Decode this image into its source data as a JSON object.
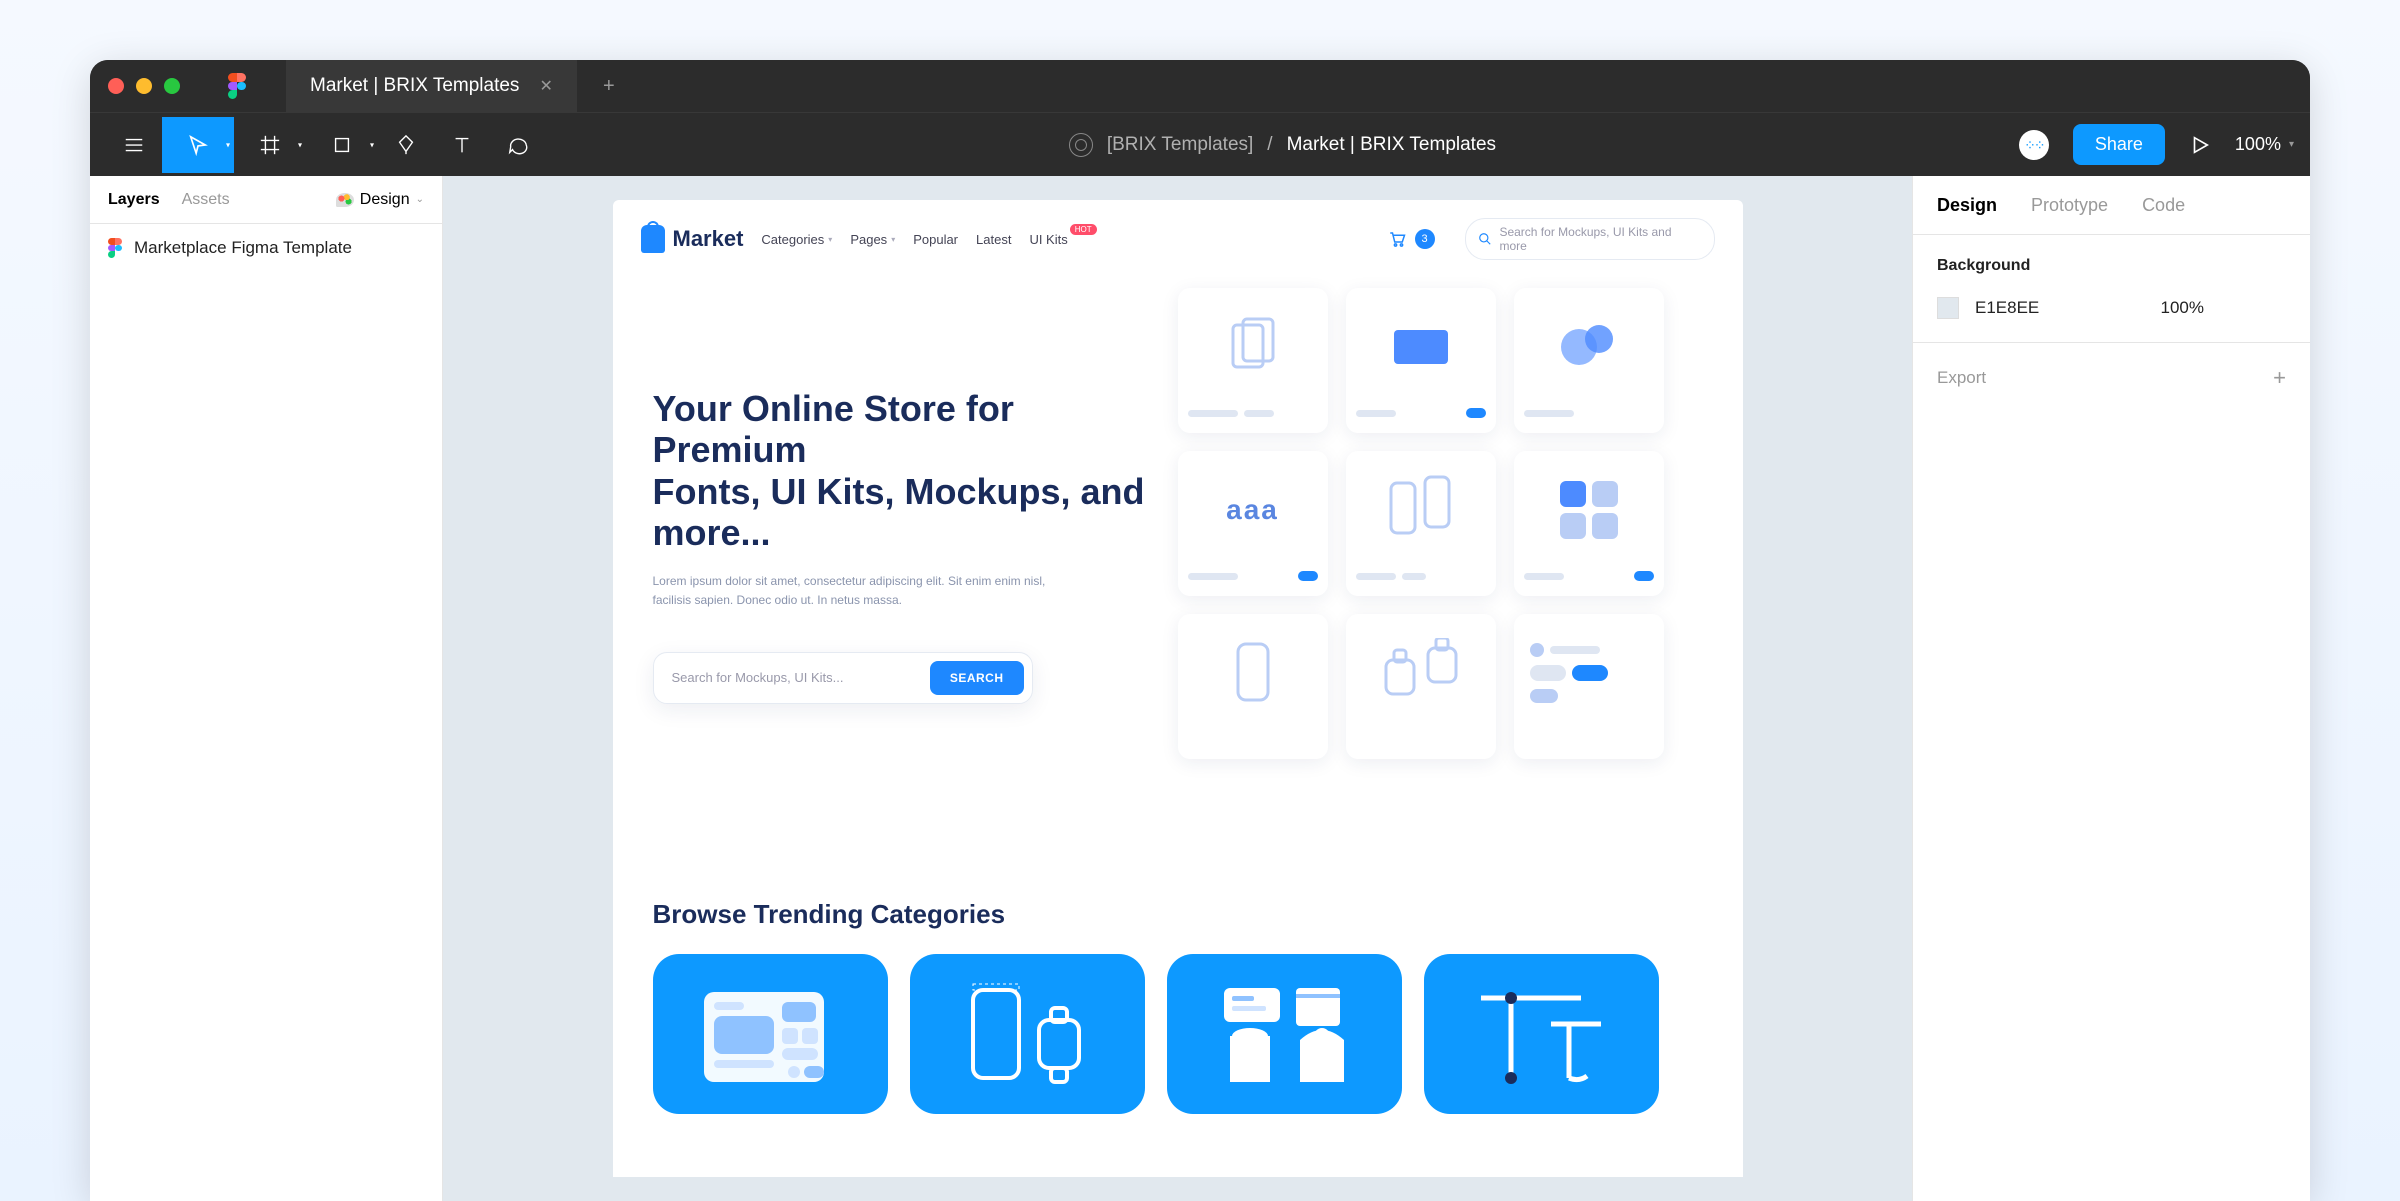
{
  "window": {
    "tab_title": "Market | BRIX Templates"
  },
  "toolbar": {
    "breadcrumb_team": "[BRIX Templates]",
    "breadcrumb_file": "Market | BRIX Templates",
    "share_label": "Share",
    "zoom_label": "100%"
  },
  "left_panel": {
    "tab_layers": "Layers",
    "tab_assets": "Assets",
    "dropdown_label": "Design",
    "layer_0": "Marketplace Figma Template"
  },
  "right_panel": {
    "tab_design": "Design",
    "tab_prototype": "Prototype",
    "tab_code": "Code",
    "section_bg": "Background",
    "bg_hex": "E1E8EE",
    "bg_opacity": "100%",
    "section_export": "Export"
  },
  "artboard": {
    "logo_text": "Market",
    "menu": {
      "categories": "Categories",
      "pages": "Pages",
      "popular": "Popular",
      "latest": "Latest",
      "uikits": "UI Kits",
      "hot_badge": "HOT"
    },
    "cart_count": "3",
    "nav_search_placeholder": "Search for Mockups, UI Kits and more",
    "hero": {
      "title_line1": "Your Online Store for Premium",
      "title_line2": "Fonts, UI Kits, Mockups, and more...",
      "description": "Lorem ipsum dolor sit amet, consectetur adipiscing elit. Sit enim enim nisl, facilisis sapien. Donec odio ut. In netus massa.",
      "search_placeholder": "Search for Mockups, UI Kits...",
      "search_btn": "SEARCH"
    },
    "trending_heading": "Browse Trending Categories"
  }
}
